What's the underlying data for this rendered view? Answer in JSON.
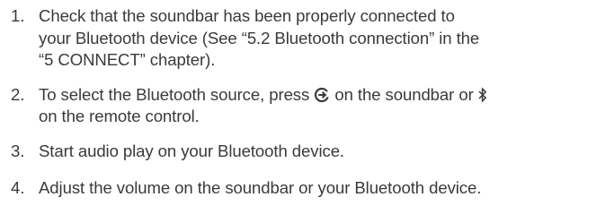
{
  "steps": [
    {
      "number": "1.",
      "lines": [
        "Check that the soundbar has been properly connected to",
        "your Bluetooth device (See “5.2 Bluetooth connection” in the",
        "“5 CONNECT” chapter)."
      ]
    },
    {
      "number": "2.",
      "text_before_source_icon": "To select the Bluetooth source, press",
      "source_icon": "source-input-icon",
      "text_between_icons": "on the soundbar or",
      "bluetooth_icon": "bluetooth-icon",
      "line_2": "on the remote control."
    },
    {
      "number": "3.",
      "text": "Start audio play on your Bluetooth device."
    },
    {
      "number": "4.",
      "text": "Adjust the volume on the soundbar or your Bluetooth device."
    }
  ],
  "colors": {
    "text": "#3a3a3a",
    "background": "#ffffff"
  }
}
